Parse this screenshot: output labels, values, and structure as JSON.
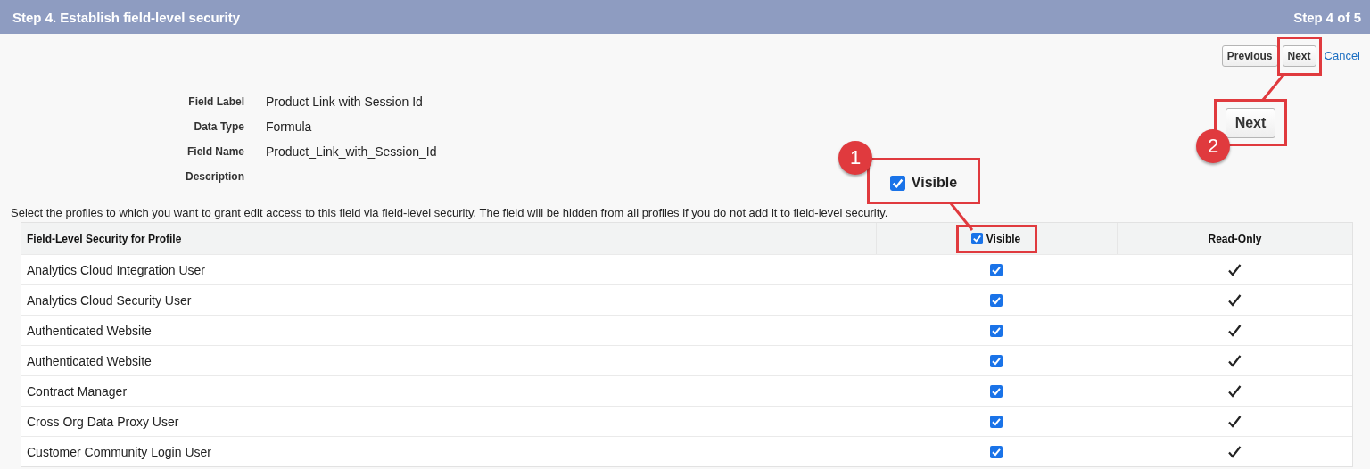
{
  "header": {
    "title": "Step 4. Establish field-level security",
    "step": "Step 4 of 5"
  },
  "toolbar": {
    "buttons": [
      {
        "label": "Previous",
        "highlighted": false
      },
      {
        "label": "Next",
        "highlighted": true
      }
    ],
    "cancel_link": "Cancel"
  },
  "details": [
    {
      "label": "Field Label",
      "value": "Product Link with Session Id"
    },
    {
      "label": "Data Type",
      "value": "Formula"
    },
    {
      "label": "Field Name",
      "value": "Product_Link_with_Session_Id"
    },
    {
      "label": "Description"
    }
  ],
  "instructions": "Select the profiles to which you want to grant edit access to this field via field-level security. The field will be hidden from all profiles if you do not add it to field-level security.",
  "table": {
    "columns": [
      {
        "label": "Field-Level Security for Profile",
        "kind": "text"
      },
      {
        "label": "Visible",
        "kind": "checkbox",
        "checked": true,
        "highlighted": true
      },
      {
        "label": "Read-Only",
        "kind": "text"
      }
    ],
    "rows": [
      {
        "profile": "Analytics Cloud Integration User",
        "visible": true,
        "read_only": true
      },
      {
        "profile": "Analytics Cloud Security User",
        "visible": true,
        "read_only": true
      },
      {
        "profile": "Authenticated Website",
        "visible": true,
        "read_only": true
      },
      {
        "profile": "Authenticated Website",
        "visible": true,
        "read_only": true
      },
      {
        "profile": "Contract Manager",
        "visible": true,
        "read_only": true
      },
      {
        "profile": "Cross Org Data Proxy User",
        "visible": true,
        "read_only": true
      },
      {
        "profile": "Customer Community Login User",
        "visible": true,
        "read_only": true
      }
    ]
  },
  "annotations": [
    {
      "number": "1",
      "kind": "checkbox",
      "label": "Visible",
      "checked": true
    },
    {
      "number": "2",
      "kind": "button",
      "label": "Next"
    }
  ]
}
